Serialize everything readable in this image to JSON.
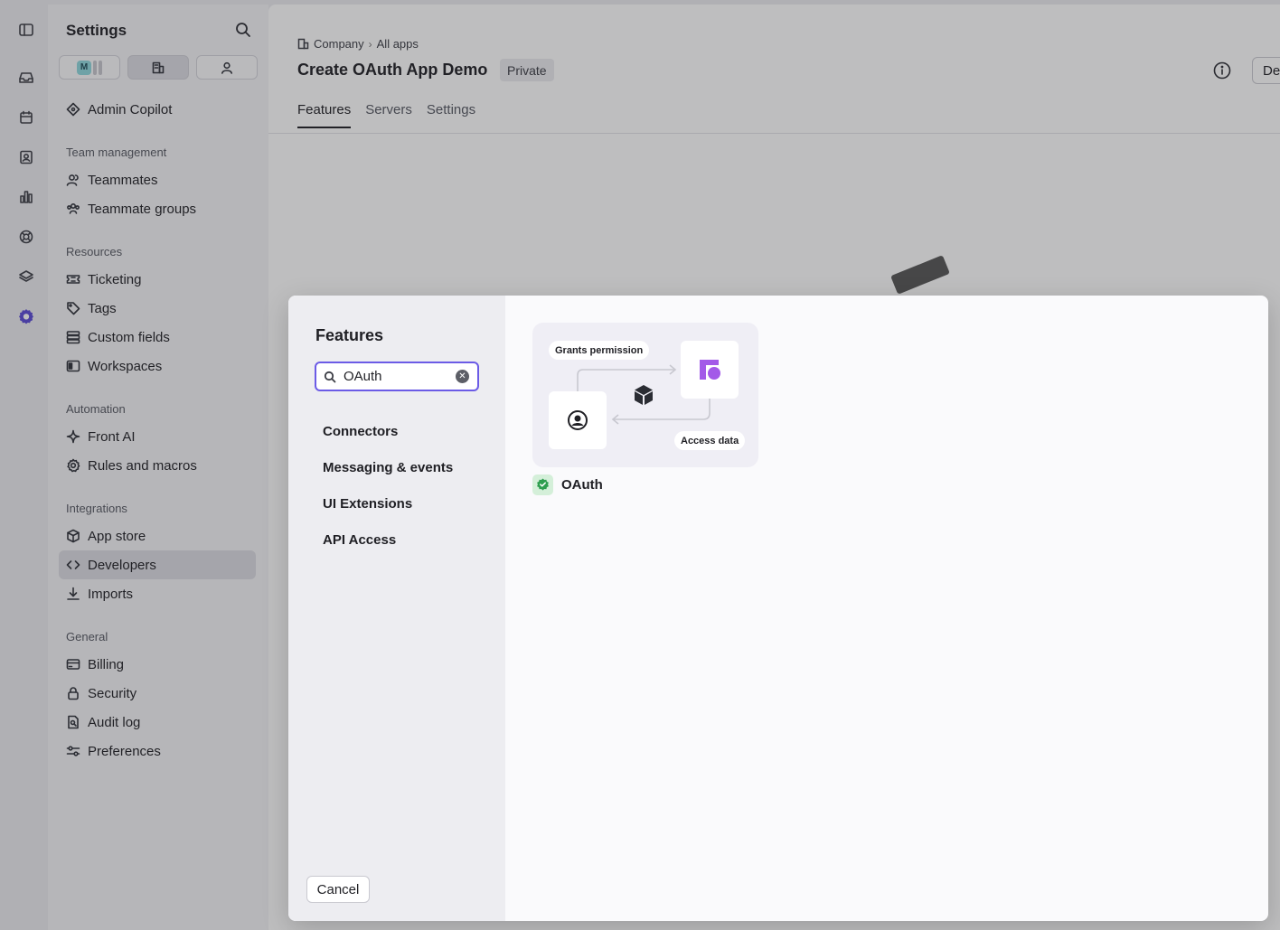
{
  "rail": {
    "icons": [
      "sidebar-toggle-icon",
      "inbox-icon",
      "calendar-icon",
      "contacts-icon",
      "analytics-icon",
      "help-icon",
      "layers-icon",
      "settings-icon"
    ]
  },
  "sidebar": {
    "title": "Settings",
    "scope_avatar": "M",
    "items": {
      "admin_copilot": "Admin Copilot",
      "teammates": "Teammates",
      "teammate_groups": "Teammate groups",
      "ticketing": "Ticketing",
      "tags": "Tags",
      "custom_fields": "Custom fields",
      "workspaces": "Workspaces",
      "front_ai": "Front AI",
      "rules_and_macros": "Rules and macros",
      "app_store": "App store",
      "developers": "Developers",
      "imports": "Imports",
      "billing": "Billing",
      "security": "Security",
      "audit_log": "Audit log",
      "preferences": "Preferences"
    },
    "sections": {
      "team_management": "Team management",
      "resources": "Resources",
      "automation": "Automation",
      "integrations": "Integrations",
      "general": "General"
    },
    "selected": "Developers"
  },
  "main": {
    "breadcrumb": [
      "Company",
      "All apps"
    ],
    "title": "Create OAuth App Demo",
    "badge": "Private",
    "truncated_button": "De",
    "tabs": [
      "Features",
      "Servers",
      "Settings"
    ],
    "active_tab": "Features"
  },
  "modal": {
    "title": "Features",
    "search": {
      "value": "OAuth",
      "placeholder": ""
    },
    "categories": [
      "Connectors",
      "Messaging & events",
      "UI Extensions",
      "API Access"
    ],
    "cancel_label": "Cancel",
    "feature_card": {
      "pill_top": "Grants permission",
      "pill_bottom": "Access data",
      "name": "OAuth",
      "status_icon": "verified-check-icon"
    }
  },
  "colors": {
    "accent": "#6b5be6",
    "brand_purple": "#a35ae8",
    "verified_green": "#2e9e4f"
  }
}
